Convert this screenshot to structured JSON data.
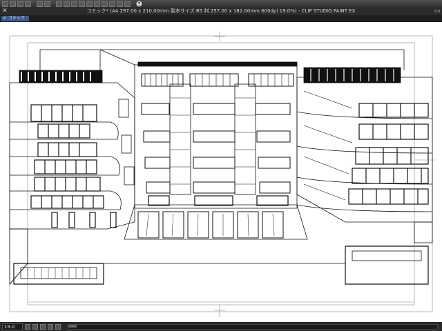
{
  "window": {
    "title": "コミック* (A4 297.00 x 210.00mm 製本サイズ:B5 判 257.00 x 182.00mm 600dpi 19.0%) - CLIP STUDIO PAINT EX"
  },
  "tab": {
    "label": "コミック"
  },
  "toolbar": {
    "icons": [
      "close-icon",
      "undo-icon",
      "save-icon",
      "transform-icon",
      "clear-icon",
      "layer-icon",
      "ruler-icon",
      "snap-icon",
      "help-icon"
    ],
    "help_label": "?"
  },
  "status": {
    "zoom": "19.0"
  },
  "colors": {
    "tab_active": "#3d5a8a",
    "background": "#3a3a3a",
    "paper": "#ffffff"
  }
}
